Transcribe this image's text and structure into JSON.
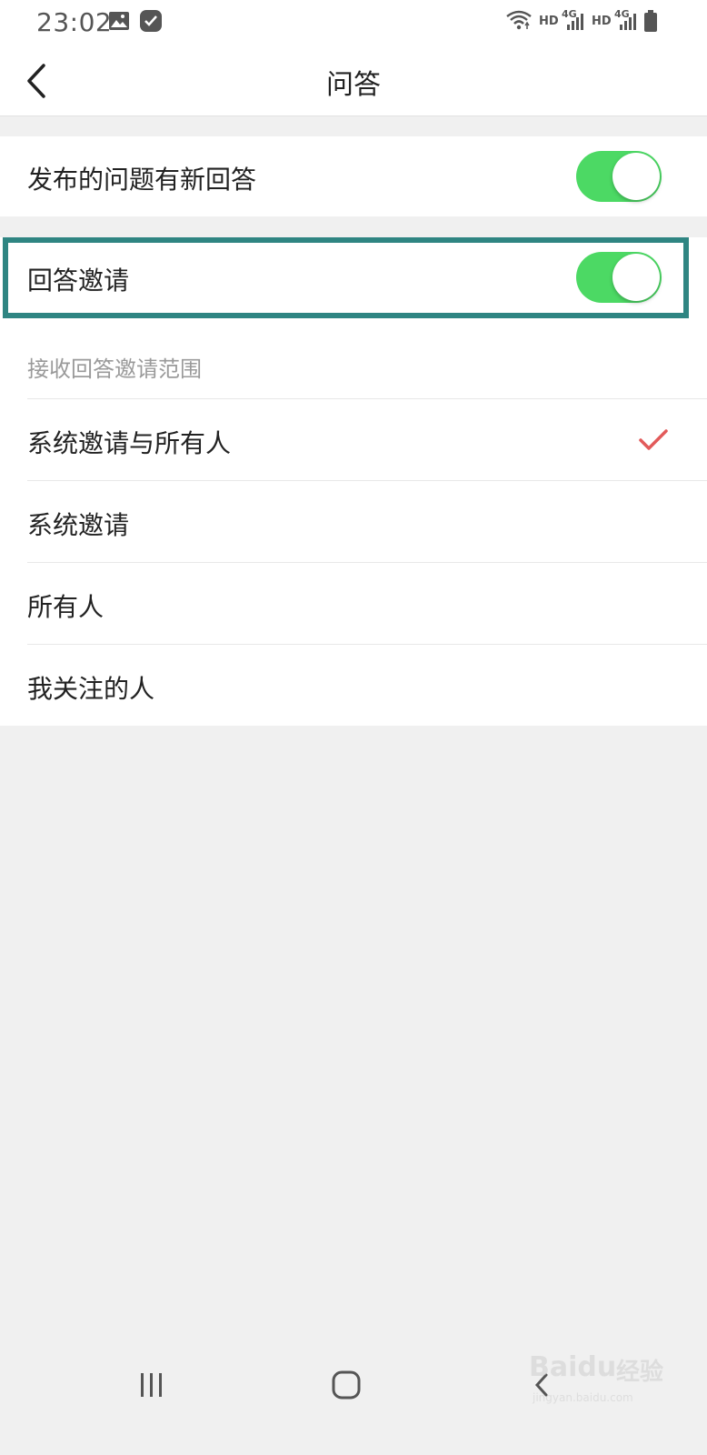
{
  "status_bar": {
    "time": "23:02",
    "signal_1_label": "HD",
    "network_1_label": "4G",
    "signal_2_label": "HD",
    "network_2_label": "4G",
    "icons": [
      "image-icon",
      "check-badge-icon",
      "wifi-icon",
      "cell-signal-icon",
      "cell-signal-icon",
      "battery-icon"
    ]
  },
  "header": {
    "title": "问答",
    "back_icon": "chevron-left-icon"
  },
  "settings": {
    "new_answer_label": "发布的问题有新回答",
    "new_answer_enabled": true,
    "answer_invite_label": "回答邀请",
    "answer_invite_enabled": true
  },
  "invite_scope": {
    "section_label": "接收回答邀请范围",
    "options": [
      {
        "label": "系统邀请与所有人",
        "selected": true
      },
      {
        "label": "系统邀请",
        "selected": false
      },
      {
        "label": "所有人",
        "selected": false
      },
      {
        "label": "我关注的人",
        "selected": false
      }
    ]
  },
  "nav_bar": {
    "icons": [
      "recent-apps-icon",
      "home-icon",
      "back-icon"
    ]
  },
  "watermark": {
    "brand": "Baidu",
    "suffix": "经验",
    "url": "jingyan.baidu.com"
  },
  "colors": {
    "toggle_on": "#4cd964",
    "check": "#e25a5a",
    "highlight": "#2f8582",
    "background": "#f0f0f0"
  }
}
